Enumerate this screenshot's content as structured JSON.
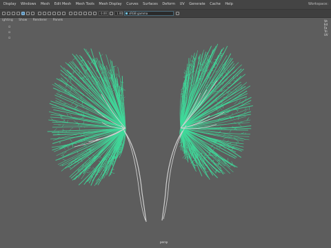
{
  "menu": {
    "items": [
      "Display",
      "Windows",
      "Mesh",
      "Edit Mesh",
      "Mesh Tools",
      "Mesh Display",
      "Curves",
      "Surfaces",
      "Deform",
      "UV",
      "Generate",
      "Cache",
      "Help"
    ],
    "workspace": "Workspace:"
  },
  "toolbar": {
    "near_clip": "0.00",
    "far_clip": "1.00",
    "camera_field": "sRGB gamma"
  },
  "panel_menu": [
    "ighting",
    "Show",
    "Renderer",
    "Panels"
  ],
  "hud": [
    "Ve",
    "Ed",
    "Fa",
    "Tri",
    "UV"
  ],
  "viewport": {
    "camera_label": "persp"
  },
  "colors": {
    "branch": "#3fd99a",
    "ureter": "#d0d0d0",
    "viewport_bg": "#5d5d5d"
  }
}
